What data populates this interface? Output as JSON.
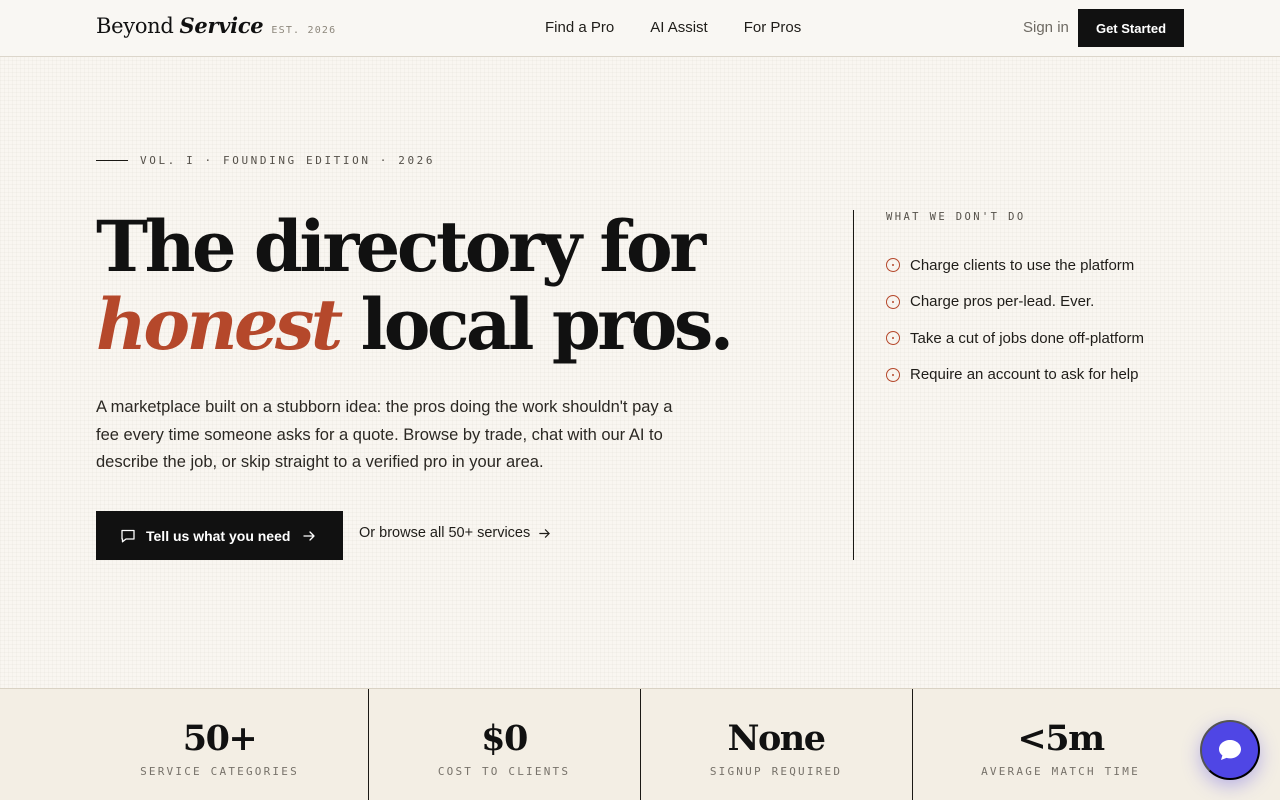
{
  "header": {
    "brand_name": "Beyond",
    "brand_italic": "Service",
    "brand_est": "EST. 2026",
    "nav": [
      "Find a Pro",
      "AI Assist",
      "For Pros"
    ],
    "sign_in": "Sign in",
    "get_started": "Get Started"
  },
  "hero": {
    "eyebrow": "VOL. I · FOUNDING EDITION · 2026",
    "title_line1": "The directory for",
    "title_accent": "honest",
    "title_line2_rest": " local pros.",
    "description": "A marketplace built on a stubborn idea: the pros doing the work shouldn't pay a fee every time someone asks for a quote. Browse by trade, chat with our AI to describe the job, or skip straight to a verified pro in your area.",
    "cta_primary": "Tell us what you need",
    "cta_secondary": "Or browse all 50+ services"
  },
  "side": {
    "heading": "WHAT WE DON'T DO",
    "items": [
      "Charge clients to use the platform",
      "Charge pros per-lead. Ever.",
      "Take a cut of jobs done off-platform",
      "Require an account to ask for help"
    ]
  },
  "stats": [
    {
      "value": "50+",
      "label": "SERVICE CATEGORIES"
    },
    {
      "value": "$0",
      "label": "COST TO CLIENTS"
    },
    {
      "value": "None",
      "label": "SIGNUP REQUIRED"
    },
    {
      "value": "<5m",
      "label": "AVERAGE MATCH TIME"
    }
  ],
  "colors": {
    "accent": "#b5482b",
    "ink": "#111111",
    "paper": "#f9f6f1",
    "chat_fab": "#4f46e5"
  },
  "icons": {
    "cta_primary": "chat-bubble-icon",
    "cta_arrow": "arrow-right-icon",
    "list_marker": "circle-dot-icon",
    "chat_fab": "chat-icon"
  }
}
